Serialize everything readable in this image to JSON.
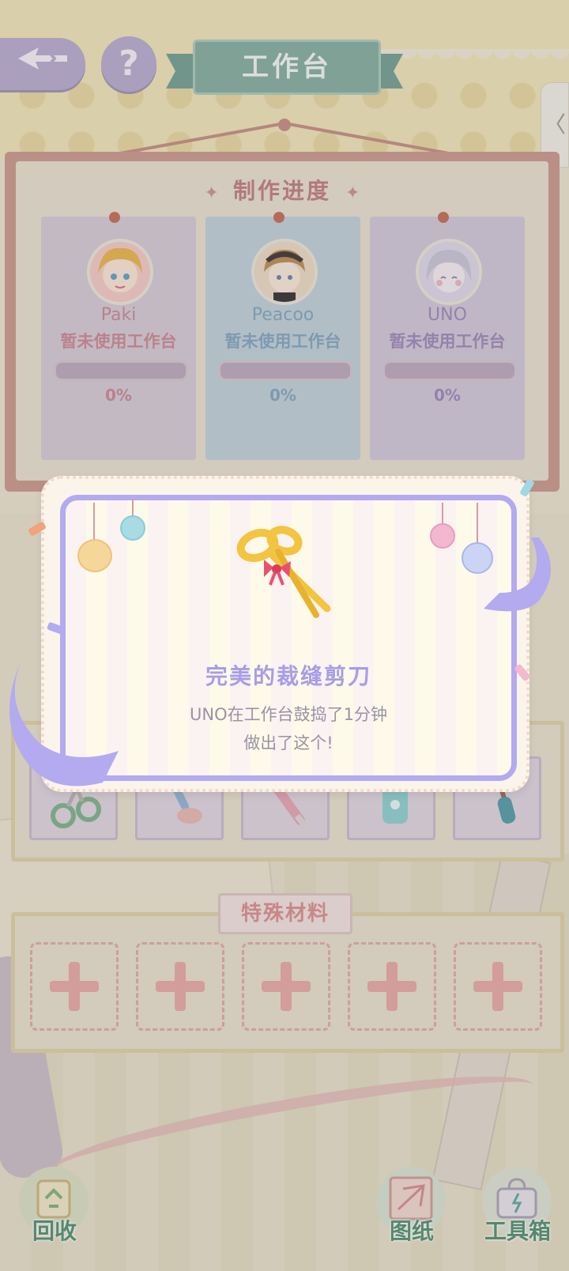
{
  "header": {
    "title": "工作台",
    "back_icon": "back-arrow-icon",
    "help_label": "?",
    "side_tab_label": "〈"
  },
  "progress": {
    "heading": "制作进度",
    "ornament": "✦",
    "cards": [
      {
        "name": "Paki",
        "status": "暂未使用工作台",
        "progress": 0,
        "percent_label": "0%"
      },
      {
        "name": "Peacoo",
        "status": "暂未使用工作台",
        "progress": 0,
        "percent_label": "0%"
      },
      {
        "name": "UNO",
        "status": "暂未使用工作台",
        "progress": 0,
        "percent_label": "0%"
      }
    ]
  },
  "popup": {
    "item_name": "完美的裁缝剪刀",
    "line1": "UNO在工作台鼓捣了1分钟",
    "line2": "做出了这个!",
    "item_icon": "golden-scissors-icon"
  },
  "special": {
    "title": "特殊材料",
    "slot_icon": "plus-icon"
  },
  "bottom": {
    "recycle_label": "回收",
    "blueprint_label": "图纸",
    "toolbox_label": "工具箱"
  },
  "colors": {
    "accent_purple": "#b3aaf0",
    "title_green": "#82ab9f",
    "heading_pink": "#bd7a82"
  }
}
